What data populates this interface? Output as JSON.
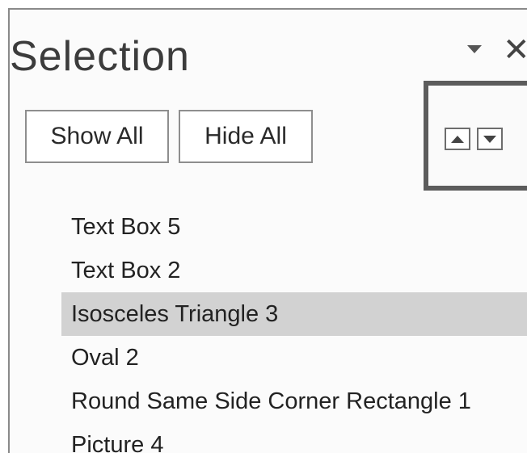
{
  "pane": {
    "title": "Selection",
    "show_all_label": "Show All",
    "hide_all_label": "Hide All",
    "close_glyph": "✕",
    "menu_icon": "triangle-down-icon",
    "reorder_icons": [
      "bring-forward-icon",
      "send-backward-icon"
    ]
  },
  "items": [
    {
      "label": "Text Box 5",
      "selected": false
    },
    {
      "label": "Text Box 2",
      "selected": false
    },
    {
      "label": "Isosceles Triangle 3",
      "selected": true
    },
    {
      "label": "Oval 2",
      "selected": false
    },
    {
      "label": "Round Same Side Corner Rectangle 1",
      "selected": false
    },
    {
      "label": "Picture 4",
      "selected": false
    }
  ],
  "colors": {
    "selected_row": "#d2d2d2",
    "button_border": "#8e8e8e"
  }
}
